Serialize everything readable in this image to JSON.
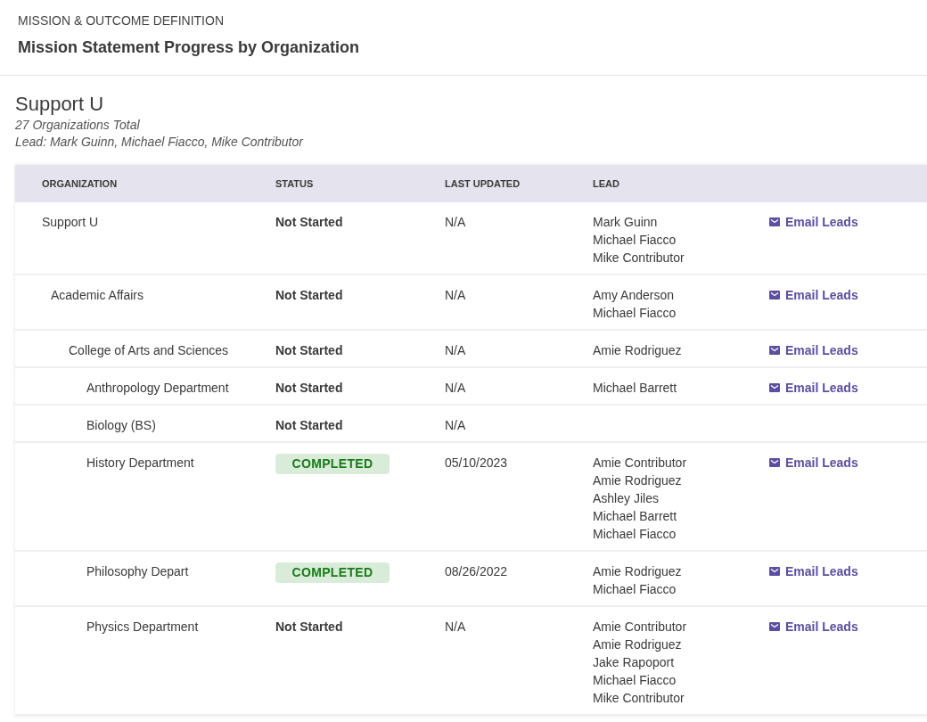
{
  "header": {
    "section": "MISSION & OUTCOME DEFINITION",
    "title": "Mission Statement Progress by Organization"
  },
  "summary": {
    "name": "Support U",
    "total": "27 Organizations Total",
    "leads": "Lead: Mark Guinn, Michael Fiacco, Mike Contributor"
  },
  "table": {
    "columns": [
      "ORGANIZATION",
      "STATUS",
      "LAST UPDATED",
      "LEAD"
    ],
    "rows": [
      {
        "organization": "Support U",
        "status": {
          "kind": "not_started",
          "label": "Not Started"
        },
        "last_updated": "N/A",
        "leads": [
          "Mark Guinn",
          "Michael Fiacco",
          "Mike Contributor"
        ],
        "action": "Email Leads",
        "children": [
          {
            "organization": "Academic Affairs",
            "status": {
              "kind": "not_started",
              "label": "Not Started"
            },
            "last_updated": "N/A",
            "leads": [
              "Amy Anderson",
              "Michael Fiacco"
            ],
            "action": "Email Leads",
            "children": [
              {
                "organization": "College of Arts and Sciences",
                "status": {
                  "kind": "not_started",
                  "label": "Not Started"
                },
                "last_updated": "N/A",
                "leads": [
                  "Amie Rodriguez"
                ],
                "action": "Email Leads",
                "children": [
                  {
                    "organization": "Anthropology Department",
                    "status": {
                      "kind": "not_started",
                      "label": "Not Started"
                    },
                    "last_updated": "N/A",
                    "leads": [
                      "Michael Barrett"
                    ],
                    "action": "Email Leads"
                  },
                  {
                    "organization": "Biology (BS)",
                    "status": {
                      "kind": "not_started",
                      "label": "Not Started"
                    },
                    "last_updated": "N/A"
                  },
                  {
                    "organization": "History Department",
                    "status": {
                      "kind": "completed",
                      "label": "COMPLETED"
                    },
                    "last_updated": "05/10/2023",
                    "leads": [
                      "Amie Contributor",
                      "Amie Rodriguez",
                      "Ashley Jiles",
                      "Michael Barrett",
                      "Michael Fiacco"
                    ],
                    "action": "Email Leads"
                  },
                  {
                    "organization": "Philosophy Depart",
                    "status": {
                      "kind": "completed",
                      "label": "COMPLETED"
                    },
                    "last_updated": "08/26/2022",
                    "leads": [
                      "Amie Rodriguez",
                      "Michael Fiacco"
                    ],
                    "action": "Email Leads"
                  },
                  {
                    "organization": "Physics Department",
                    "status": {
                      "kind": "not_started",
                      "label": "Not Started"
                    },
                    "last_updated": "N/A",
                    "leads": [
                      "Amie Contributor",
                      "Amie Rodriguez",
                      "Jake Rapoport",
                      "Michael Fiacco",
                      "Mike Contributor"
                    ],
                    "action": "Email Leads"
                  }
                ]
              }
            ]
          }
        ]
      }
    ]
  }
}
